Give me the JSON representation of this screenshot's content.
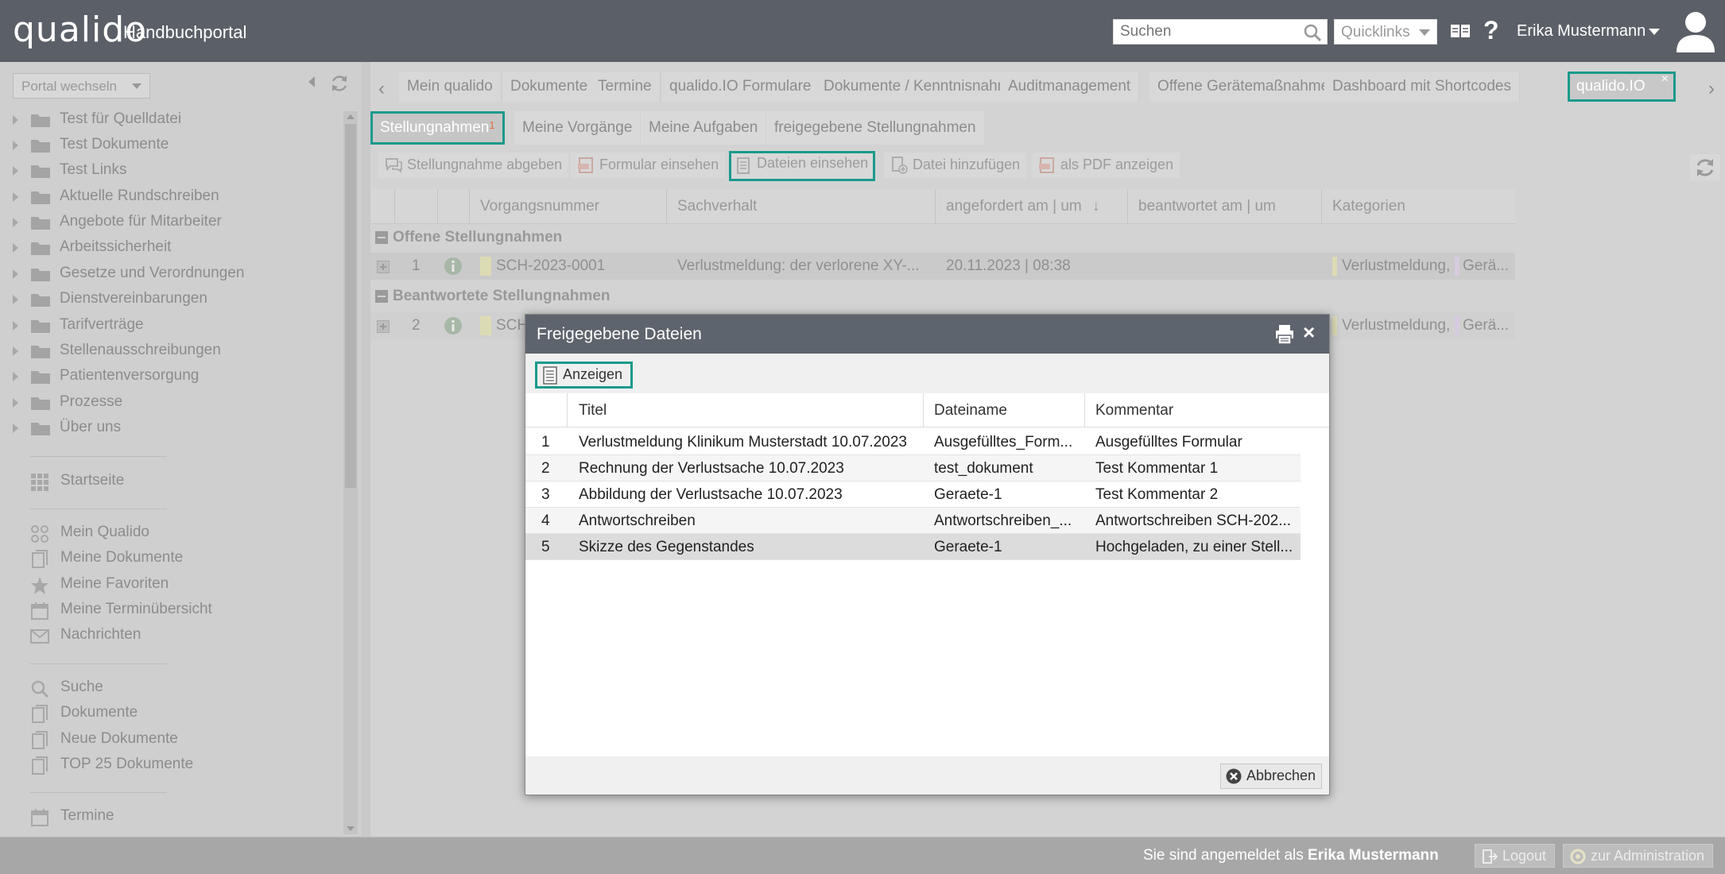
{
  "header": {
    "logo": "qualido",
    "portal_title": "Handbuchportal",
    "search_placeholder": "Suchen",
    "quicklinks_label": "Quicklinks",
    "help_label": "?",
    "user_name": "Erika Mustermann"
  },
  "sidebar": {
    "portal_switch_label": "Portal wechseln",
    "tree_items": [
      {
        "label": "Test für Quelldatei"
      },
      {
        "label": "Test Dokumente"
      },
      {
        "label": "Test Links"
      },
      {
        "label": "Aktuelle Rundschreiben"
      },
      {
        "label": "Angebote für Mitarbeiter"
      },
      {
        "label": "Arbeitssicherheit"
      },
      {
        "label": "Gesetze und Verordnungen"
      },
      {
        "label": "Dienstvereinbarungen"
      },
      {
        "label": "Tarifverträge"
      },
      {
        "label": "Stellenausschreibungen"
      },
      {
        "label": "Patientenversorgung"
      },
      {
        "label": "Prozesse"
      },
      {
        "label": "Über uns"
      }
    ],
    "nav_groups": [
      [
        {
          "label": "Startseite",
          "icon": "grid-icon"
        }
      ],
      [
        {
          "label": "Mein Qualido",
          "icon": "apps-icon"
        },
        {
          "label": "Meine Dokumente",
          "icon": "documents-icon"
        },
        {
          "label": "Meine Favoriten",
          "icon": "star-icon"
        },
        {
          "label": "Meine Terminübersicht",
          "icon": "calendar-icon"
        },
        {
          "label": "Nachrichten",
          "icon": "mail-icon"
        }
      ],
      [
        {
          "label": "Suche",
          "icon": "search-icon"
        },
        {
          "label": "Dokumente",
          "icon": "documents-icon"
        },
        {
          "label": "Neue Dokumente",
          "icon": "documents-icon"
        },
        {
          "label": "TOP 25 Dokumente",
          "icon": "documents-icon"
        }
      ],
      [
        {
          "label": "Termine",
          "icon": "calendar-icon"
        }
      ]
    ]
  },
  "main": {
    "top_tabs": [
      {
        "label": "Mein qualido"
      },
      {
        "label": "Dokumente"
      },
      {
        "label": "Termine"
      },
      {
        "label": "qualido.IO Formulare"
      },
      {
        "label": "Dokumente / Kenntnisnahme"
      },
      {
        "label": "Auditmanagement"
      },
      {
        "label": "Offene Gerätemaßnahmen"
      },
      {
        "label": "Dashboard mit Shortcodes"
      },
      {
        "label": "qualido.IO",
        "active": true
      }
    ],
    "sub_tabs": [
      {
        "label": "Stellungnahmen",
        "badge": "1",
        "active": true
      },
      {
        "label": "Meine Vorgänge"
      },
      {
        "label": "Meine Aufgaben"
      },
      {
        "label": "freigegebene Stellungnahmen"
      }
    ],
    "toolbar": {
      "submit_label": "Stellungnahme abgeben",
      "form_label": "Formular einsehen",
      "files_label": "Dateien einsehen",
      "add_file_label": "Datei hinzufügen",
      "pdf_label": "als PDF anzeigen"
    },
    "grid": {
      "columns": [
        "Vorgangsnummer",
        "Sachverhalt",
        "angefordert am | um",
        "beantwortet am | um",
        "Kategorien"
      ],
      "groups": [
        {
          "label": "Offene Stellungnahmen",
          "rows": [
            {
              "num": "1",
              "vorgang": "SCH-2023-0001",
              "sachverhalt": "Verlustmeldung: der verlorene XY-...",
              "angefordert": "20.11.2023 | 08:38",
              "beantwortet": "",
              "kategorie1": "Verlustmeldung,",
              "kategorie2": "Gerä..."
            }
          ]
        },
        {
          "label": "Beantwortete Stellungnahmen",
          "rows": [
            {
              "num": "2",
              "vorgang": "SCH",
              "sachverhalt": "",
              "angefordert": "",
              "beantwortet": "",
              "kategorie1": "Verlustmeldung,",
              "kategorie2": "Gerä..."
            }
          ]
        }
      ]
    }
  },
  "footer": {
    "logged_in_prefix": "Sie sind angemeldet als",
    "logged_in_user": "Erika Mustermann",
    "logout_label": "Logout",
    "admin_label": "zur Administration"
  },
  "modal": {
    "title": "Freigegebene Dateien",
    "show_label": "Anzeigen",
    "columns": [
      "Titel",
      "Dateiname",
      "Kommentar"
    ],
    "rows": [
      {
        "num": "1",
        "titel": "Verlustmeldung Klinikum Musterstadt 10.07.2023",
        "dateiname": "Ausgefülltes_Form...",
        "kommentar": "Ausgefülltes Formular"
      },
      {
        "num": "2",
        "titel": "Rechnung der Verlustsache 10.07.2023",
        "dateiname": "test_dokument",
        "kommentar": "Test Kommentar 1"
      },
      {
        "num": "3",
        "titel": "Abbildung der Verlustsache 10.07.2023",
        "dateiname": "Geraete-1",
        "kommentar": "Test Kommentar 2"
      },
      {
        "num": "4",
        "titel": "Antwortschreiben",
        "dateiname": "Antwortschreiben_...",
        "kommentar": "Antwortschreiben SCH-202..."
      },
      {
        "num": "5",
        "titel": "Skizze des Gegenstandes",
        "dateiname": "Geraete-1",
        "kommentar": "Hochgeladen, zu einer Stell...",
        "selected": true
      }
    ],
    "cancel_label": "Abbrechen"
  },
  "colors": {
    "accent": "#1a9a8c",
    "header_bg": "#5b6068",
    "modal_header_bg": "#5e646d"
  }
}
